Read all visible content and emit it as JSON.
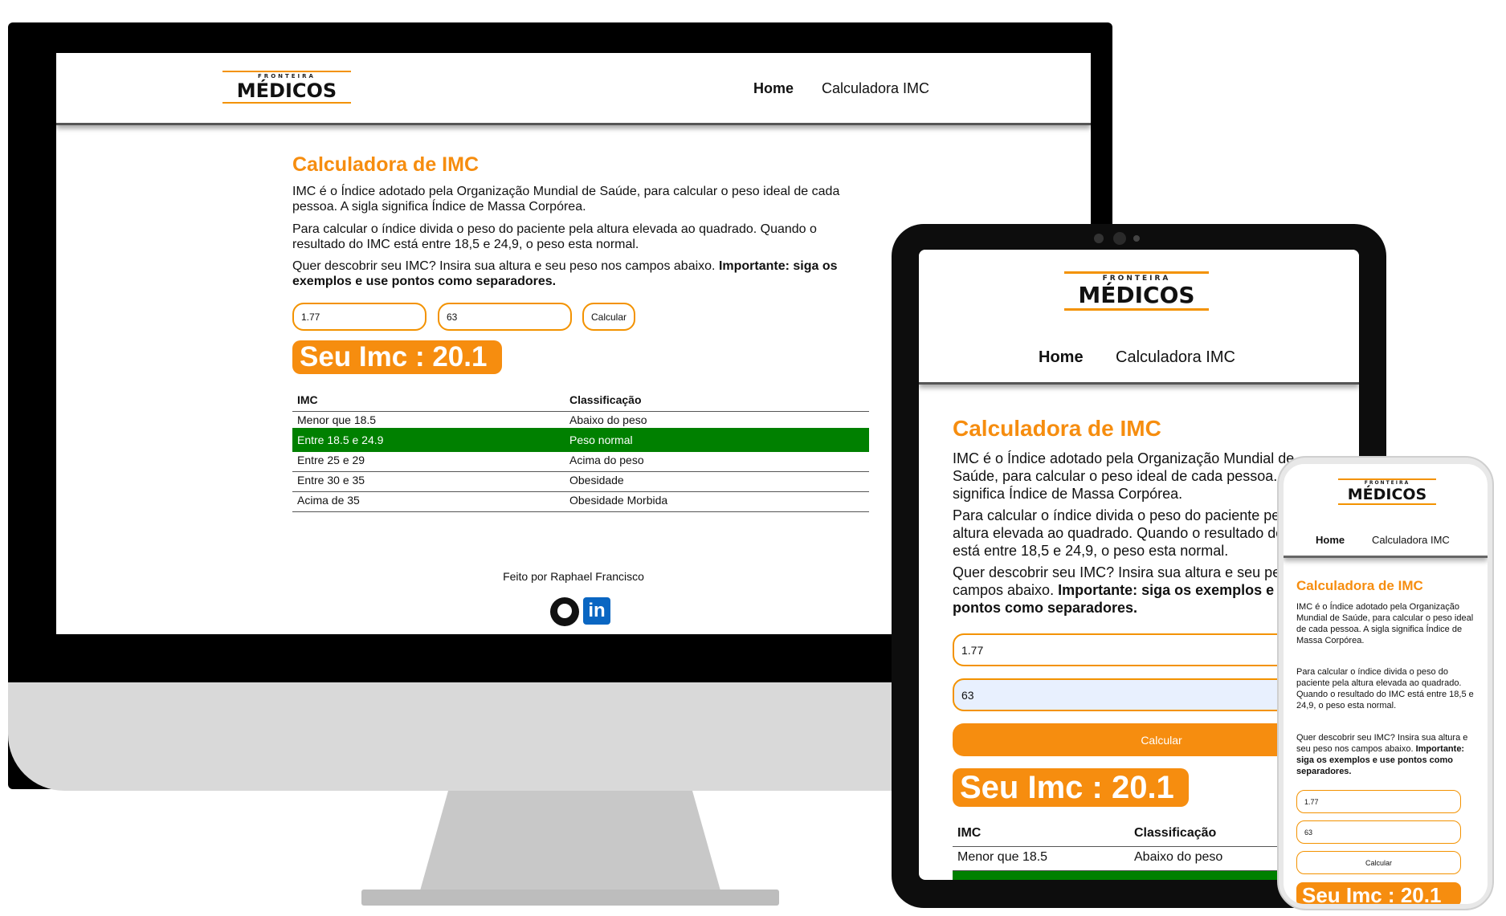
{
  "brand": {
    "small": "FRONTEIRA",
    "big": "MÉDICOS",
    "accent_color": "#f68d0f",
    "highlight_color": "#008000"
  },
  "nav": {
    "home": "Home",
    "calc": "Calculadora IMC"
  },
  "page": {
    "title": "Calculadora de IMC",
    "p1": "IMC é o Índice adotado pela Organização Mundial de Saúde, para calcular o peso ideal de cada pessoa. A sigla significa Índice de Massa Corpórea.",
    "p2": "Para calcular o índice divida o peso do paciente pela altura elevada ao quadrado. Quando o resultado do IMC está entre 18,5 e 24,9, o peso esta normal.",
    "p3_text": "Quer descobrir seu IMC? Insira sua altura e seu peso nos campos abaixo. ",
    "p3_bold": "Importante: siga os exemplos e use pontos como separadores.",
    "height_value": "1.77",
    "weight_value": "63",
    "calc_button": "Calcular",
    "result": "Seu Imc : 20.1"
  },
  "table": {
    "headers": [
      "IMC",
      "Classificação"
    ],
    "rows": [
      {
        "imc": "Menor que 18.5",
        "class": "Abaixo do peso"
      },
      {
        "imc": "Entre 18.5 e 24.9",
        "class": "Peso normal"
      },
      {
        "imc": "Entre 25 e 29",
        "class": "Acima do peso"
      },
      {
        "imc": "Entre 30 e 35",
        "class": "Obesidade"
      },
      {
        "imc": "Acima de 35",
        "class": "Obesidade Morbida"
      }
    ]
  },
  "footer": {
    "credit": "Feito por Raphael Francisco",
    "github_icon": "github-icon",
    "linkedin_icon": "linkedin-icon",
    "linkedin_text": "in"
  }
}
